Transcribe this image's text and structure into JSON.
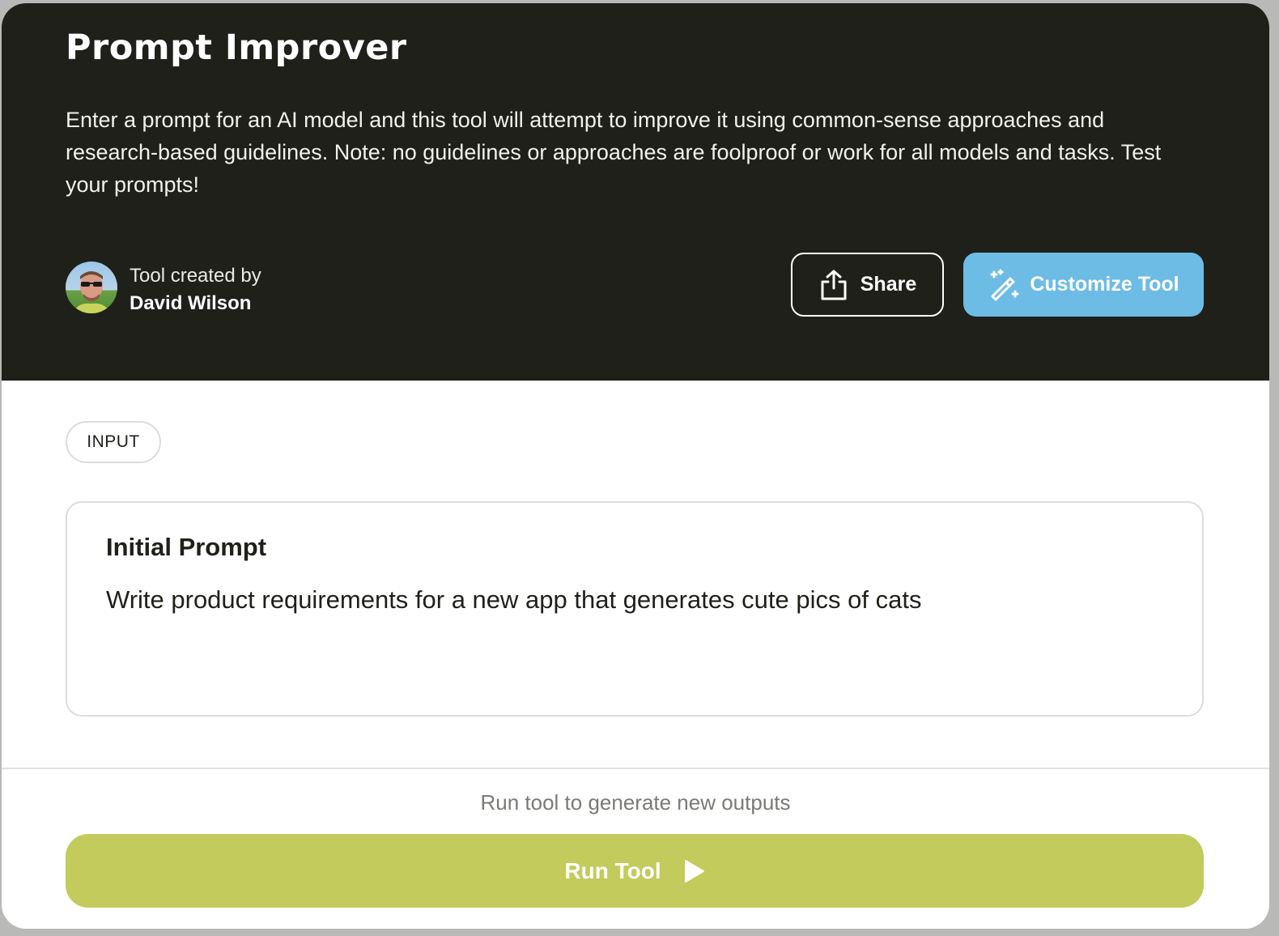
{
  "header": {
    "title": "Prompt Improver",
    "description": "Enter a prompt for an AI model and this tool will attempt to improve it using common-sense approaches and research-based guidelines. Note: no guidelines or approaches are foolproof or work for all models and tasks. Test your prompts!",
    "creator_label": "Tool created by",
    "creator_name": "David Wilson",
    "share_label": "Share",
    "customize_label": "Customize Tool"
  },
  "input_section": {
    "badge": "INPUT",
    "field_label": "Initial Prompt",
    "field_value": "Write product requirements for a new app that generates cute pics of cats"
  },
  "footer": {
    "status": "Run tool to generate new outputs",
    "run_label": "Run Tool"
  },
  "icons": {
    "share": "share-icon",
    "customize": "magic-wand-icon",
    "run": "play-icon"
  },
  "colors": {
    "hero_background": "#1f201a",
    "customize_button": "#6cbce6",
    "run_button": "#c2cb5c"
  }
}
